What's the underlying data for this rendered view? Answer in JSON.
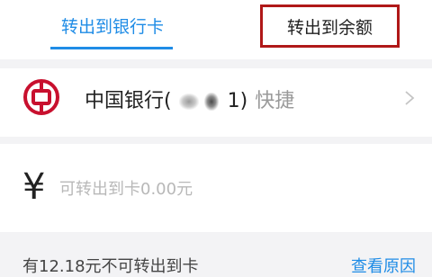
{
  "tabs": {
    "bank_card": "转出到银行卡",
    "balance": "转出到余额",
    "active": "bank_card",
    "highlight_color": "#b01818"
  },
  "bank": {
    "name": "中国银行(",
    "masked_card_number_visible": "1",
    "tail": ")",
    "tag": "快捷",
    "logo_icon": "bank-of-china-logo-icon",
    "logo_color": "#c8102e"
  },
  "amount": {
    "currency_symbol": "¥",
    "placeholder": "可转出到卡0.00元",
    "value": ""
  },
  "note": {
    "text": "有12.18元不可转出到卡",
    "link": "查看原因"
  },
  "colors": {
    "accent": "#1f8ce6",
    "background": "#f3f3f5"
  }
}
